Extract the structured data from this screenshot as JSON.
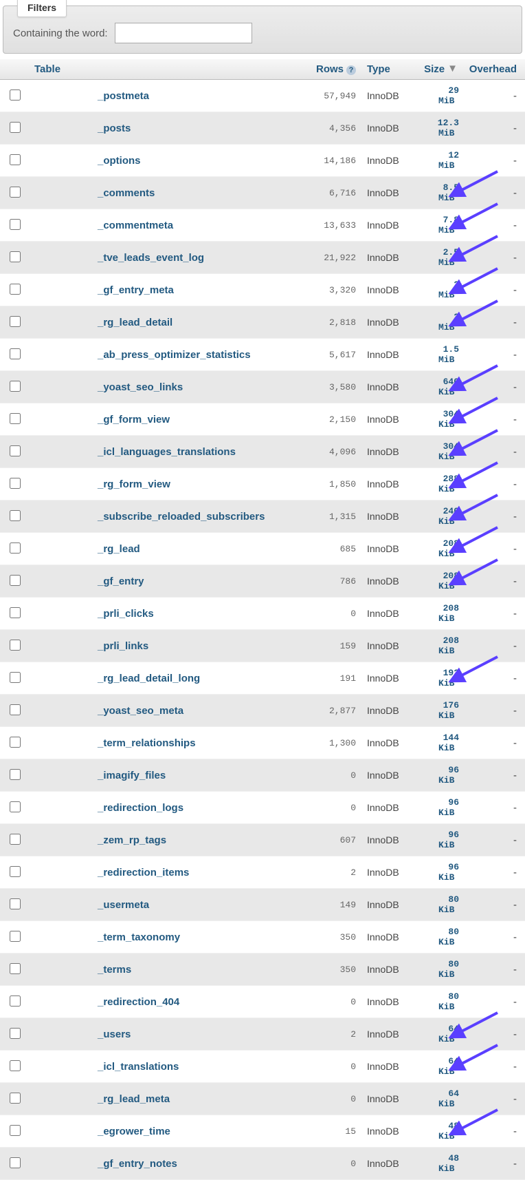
{
  "filters": {
    "legend": "Filters",
    "containing_label": "Containing the word:",
    "containing_value": ""
  },
  "columns": {
    "table": "Table",
    "rows": "Rows",
    "type": "Type",
    "size": "Size",
    "overhead": "Overhead"
  },
  "tables": [
    {
      "name": "_postmeta",
      "rows": "57,949",
      "type": "InnoDB",
      "size_num": "29",
      "size_unit": "MiB",
      "overhead": "-",
      "arrow": false
    },
    {
      "name": "_posts",
      "rows": "4,356",
      "type": "InnoDB",
      "size_num": "12.3",
      "size_unit": "MiB",
      "overhead": "-",
      "arrow": false
    },
    {
      "name": "_options",
      "rows": "14,186",
      "type": "InnoDB",
      "size_num": "12",
      "size_unit": "MiB",
      "overhead": "-",
      "arrow": false
    },
    {
      "name": "_comments",
      "rows": "6,716",
      "type": "InnoDB",
      "size_num": "8.5",
      "size_unit": "MiB",
      "overhead": "-",
      "arrow": true
    },
    {
      "name": "_commentmeta",
      "rows": "13,633",
      "type": "InnoDB",
      "size_num": "7.8",
      "size_unit": "MiB",
      "overhead": "-",
      "arrow": true
    },
    {
      "name": "_tve_leads_event_log",
      "rows": "21,922",
      "type": "InnoDB",
      "size_num": "2.5",
      "size_unit": "MiB",
      "overhead": "-",
      "arrow": true
    },
    {
      "name": "_gf_entry_meta",
      "rows": "3,320",
      "type": "InnoDB",
      "size_num": "2",
      "size_unit": "MiB",
      "overhead": "-",
      "arrow": true
    },
    {
      "name": "_rg_lead_detail",
      "rows": "2,818",
      "type": "InnoDB",
      "size_num": "2",
      "size_unit": "MiB",
      "overhead": "-",
      "arrow": true
    },
    {
      "name": "_ab_press_optimizer_statistics",
      "rows": "5,617",
      "type": "InnoDB",
      "size_num": "1.5",
      "size_unit": "MiB",
      "overhead": "-",
      "arrow": false
    },
    {
      "name": "_yoast_seo_links",
      "rows": "3,580",
      "type": "InnoDB",
      "size_num": "640",
      "size_unit": "KiB",
      "overhead": "-",
      "arrow": true
    },
    {
      "name": "_gf_form_view",
      "rows": "2,150",
      "type": "InnoDB",
      "size_num": "304",
      "size_unit": "KiB",
      "overhead": "-",
      "arrow": true
    },
    {
      "name": "_icl_languages_translations",
      "rows": "4,096",
      "type": "InnoDB",
      "size_num": "304",
      "size_unit": "KiB",
      "overhead": "-",
      "arrow": true
    },
    {
      "name": "_rg_form_view",
      "rows": "1,850",
      "type": "InnoDB",
      "size_num": "288",
      "size_unit": "KiB",
      "overhead": "-",
      "arrow": true
    },
    {
      "name": "_subscribe_reloaded_subscribers",
      "rows": "1,315",
      "type": "InnoDB",
      "size_num": "240",
      "size_unit": "KiB",
      "overhead": "-",
      "arrow": true
    },
    {
      "name": "_rg_lead",
      "rows": "685",
      "type": "InnoDB",
      "size_num": "208",
      "size_unit": "KiB",
      "overhead": "-",
      "arrow": true
    },
    {
      "name": "_gf_entry",
      "rows": "786",
      "type": "InnoDB",
      "size_num": "208",
      "size_unit": "KiB",
      "overhead": "-",
      "arrow": true
    },
    {
      "name": "_prli_clicks",
      "rows": "0",
      "type": "InnoDB",
      "size_num": "208",
      "size_unit": "KiB",
      "overhead": "-",
      "arrow": false
    },
    {
      "name": "_prli_links",
      "rows": "159",
      "type": "InnoDB",
      "size_num": "208",
      "size_unit": "KiB",
      "overhead": "-",
      "arrow": false
    },
    {
      "name": "_rg_lead_detail_long",
      "rows": "191",
      "type": "InnoDB",
      "size_num": "192",
      "size_unit": "KiB",
      "overhead": "-",
      "arrow": true
    },
    {
      "name": "_yoast_seo_meta",
      "rows": "2,877",
      "type": "InnoDB",
      "size_num": "176",
      "size_unit": "KiB",
      "overhead": "-",
      "arrow": false
    },
    {
      "name": "_term_relationships",
      "rows": "1,300",
      "type": "InnoDB",
      "size_num": "144",
      "size_unit": "KiB",
      "overhead": "-",
      "arrow": false
    },
    {
      "name": "_imagify_files",
      "rows": "0",
      "type": "InnoDB",
      "size_num": "96",
      "size_unit": "KiB",
      "overhead": "-",
      "arrow": false
    },
    {
      "name": "_redirection_logs",
      "rows": "0",
      "type": "InnoDB",
      "size_num": "96",
      "size_unit": "KiB",
      "overhead": "-",
      "arrow": false
    },
    {
      "name": "_zem_rp_tags",
      "rows": "607",
      "type": "InnoDB",
      "size_num": "96",
      "size_unit": "KiB",
      "overhead": "-",
      "arrow": false
    },
    {
      "name": "_redirection_items",
      "rows": "2",
      "type": "InnoDB",
      "size_num": "96",
      "size_unit": "KiB",
      "overhead": "-",
      "arrow": false
    },
    {
      "name": "_usermeta",
      "rows": "149",
      "type": "InnoDB",
      "size_num": "80",
      "size_unit": "KiB",
      "overhead": "-",
      "arrow": false
    },
    {
      "name": "_term_taxonomy",
      "rows": "350",
      "type": "InnoDB",
      "size_num": "80",
      "size_unit": "KiB",
      "overhead": "-",
      "arrow": false
    },
    {
      "name": "_terms",
      "rows": "350",
      "type": "InnoDB",
      "size_num": "80",
      "size_unit": "KiB",
      "overhead": "-",
      "arrow": false
    },
    {
      "name": "_redirection_404",
      "rows": "0",
      "type": "InnoDB",
      "size_num": "80",
      "size_unit": "KiB",
      "overhead": "-",
      "arrow": false
    },
    {
      "name": "_users",
      "rows": "2",
      "type": "InnoDB",
      "size_num": "64",
      "size_unit": "KiB",
      "overhead": "-",
      "arrow": true
    },
    {
      "name": "_icl_translations",
      "rows": "0",
      "type": "InnoDB",
      "size_num": "64",
      "size_unit": "KiB",
      "overhead": "-",
      "arrow": true
    },
    {
      "name": "_rg_lead_meta",
      "rows": "0",
      "type": "InnoDB",
      "size_num": "64",
      "size_unit": "KiB",
      "overhead": "-",
      "arrow": false
    },
    {
      "name": "_egrower_time",
      "rows": "15",
      "type": "InnoDB",
      "size_num": "48",
      "size_unit": "KiB",
      "overhead": "-",
      "arrow": true
    },
    {
      "name": "_gf_entry_notes",
      "rows": "0",
      "type": "InnoDB",
      "size_num": "48",
      "size_unit": "KiB",
      "overhead": "-",
      "arrow": false
    }
  ]
}
